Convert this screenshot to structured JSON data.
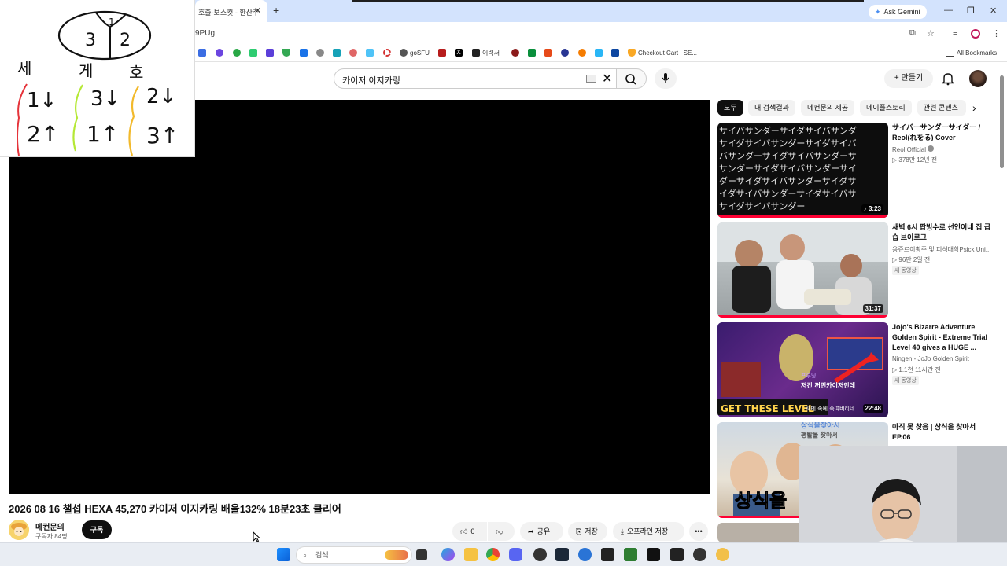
{
  "browser": {
    "tab_title": "호출-보스컷 - 환산주",
    "ask_gemini": "Ask Gemini",
    "url_fragment": "9PUg",
    "bookmarks": [
      {
        "label": "goSFU"
      },
      {
        "label": "이력서"
      },
      {
        "label": "Checkout Cart | SE..."
      }
    ],
    "all_bookmarks": "All Bookmarks"
  },
  "header": {
    "search_value": "카이저 이지카링",
    "create_label": "만들기"
  },
  "video": {
    "title": "2026 08 16 챌섭 HEXA 45,270 카이저 이지카링 배율132% 18분23초 클리어",
    "channel_name": "메컨문의",
    "subscribers": "구독자 84명",
    "subscribe_label": "구독",
    "like_count": "0",
    "share_label": "공유",
    "save_label": "저장",
    "offline_label": "오프라인 저장"
  },
  "chips": [
    "모두",
    "내 검색결과",
    "메컨문의 제공",
    "메이플스토리",
    "관련 콘텐츠"
  ],
  "recommendations": [
    {
      "title": "サイバーサンダーサイダー / Reol(れをる) Cover",
      "channel": "Reol Official",
      "meta": "▷ 378만   12년 전",
      "duration": "3:23",
      "badge": ""
    },
    {
      "title": "새벽 6시 팝빙수로 선인이네 집 급습 브이로그",
      "channel": "용쥬르이황주 및 피식대학Psick Uni...",
      "meta": "▷ 96만   2일 전",
      "duration": "31:37",
      "badge": "새 동영상"
    },
    {
      "title": "Jojo's Bizarre Adventure Golden Spirit - Extreme Trial Level 40 gives a HUGE ...",
      "channel": "Ningen - JoJo Golden Spirit",
      "meta": "▷ 1.1천   11시간 전",
      "duration": "22:48",
      "badge": "새 동영상"
    },
    {
      "title": "아직 못 찾음 | 상식을 찾아서 EP.06",
      "channel": "",
      "meta": "",
      "duration": "",
      "badge": ""
    }
  ],
  "thumb_text": {
    "jojo_banner": "GET THESE LEVEL",
    "jojo_caption": "저긴 꺼먼카이저인데",
    "jojo_caption2": "웨테 속에 속여버리네",
    "jojo_tag": "프루딩",
    "vlog3_top": "상식을찾아서",
    "vlog3_sub": "평탈을 찾아서",
    "vlog3_big": "상식을"
  },
  "note": {
    "circle": {
      "left": "3",
      "right": "2",
      "top": "1"
    },
    "headers": [
      "세",
      "게",
      "호"
    ],
    "row1": [
      "1↓",
      "3↓",
      "2↓"
    ],
    "row2": [
      "2↑",
      "1↑",
      "3↑"
    ]
  },
  "taskbar": {
    "search_placeholder": "검색"
  }
}
